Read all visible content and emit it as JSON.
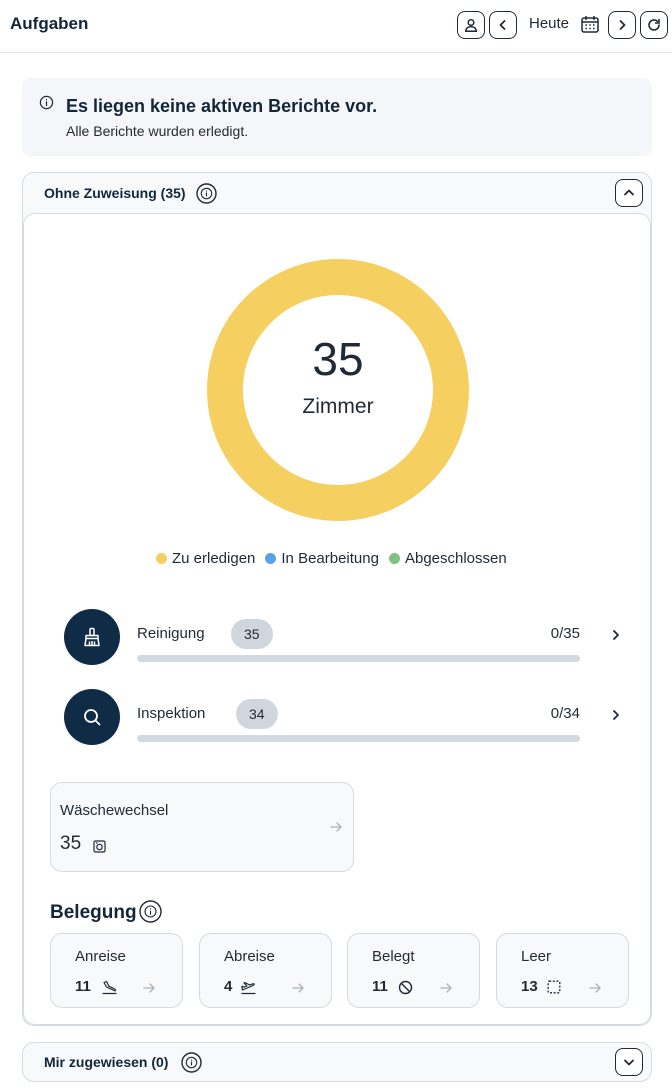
{
  "header": {
    "title": "Aufgaben",
    "today_label": "Heute"
  },
  "notice": {
    "title": "Es liegen keine aktiven Berichte vor.",
    "subtitle": "Alle Berichte wurden erledigt."
  },
  "unassigned": {
    "title": "Ohne Zuweisung (35)",
    "chart_data": {
      "type": "pie",
      "center_value": "35",
      "center_label": "Zimmer",
      "legend": [
        {
          "name": "Zu erledigen",
          "color": "#f5cf5f",
          "value": 35
        },
        {
          "name": "In Bearbeitung",
          "color": "#5aa1e8",
          "value": 0
        },
        {
          "name": "Abgeschlossen",
          "color": "#7cc47f",
          "value": 0
        }
      ]
    },
    "tasks": [
      {
        "label": "Reinigung",
        "badge": "35",
        "count": "0/35",
        "icon": "broom-icon",
        "progress": 0
      },
      {
        "label": "Inspektion",
        "badge": "34",
        "count": "0/34",
        "icon": "search-icon",
        "progress": 0
      }
    ],
    "linen": {
      "title": "Wäschewechsel",
      "value": "35"
    },
    "occupancy": {
      "title": "Belegung",
      "cards": [
        {
          "title": "Anreise",
          "value": "11",
          "icon": "arrival-icon"
        },
        {
          "title": "Abreise",
          "value": "4",
          "icon": "departure-icon"
        },
        {
          "title": "Belegt",
          "value": "11",
          "icon": "occupied-icon"
        },
        {
          "title": "Leer",
          "value": "13",
          "icon": "empty-icon"
        }
      ]
    }
  },
  "assigned": {
    "title": "Mir zugewiesen (0)"
  }
}
